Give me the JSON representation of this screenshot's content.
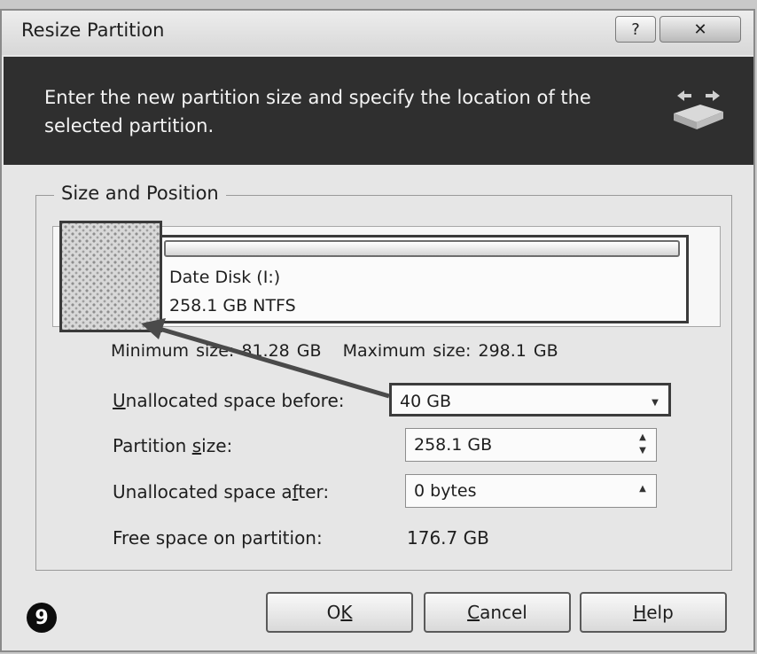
{
  "window": {
    "title": "Resize Partition",
    "help_glyph": "?",
    "close_glyph": "✕"
  },
  "header": {
    "instruction": "Enter the new partition size and specify the location of the selected partition.",
    "icon": "disk-resize-icon"
  },
  "size_position": {
    "group_label": "Size and Position",
    "partition_name": "Date Disk (I:)",
    "partition_info": "258.1 GB  NTFS",
    "minimum_size": "Minimum size: 81.28 GB",
    "maximum_size": "Maximum size: 298.1 GB",
    "fields": {
      "unallocated_before": {
        "label_key": "U",
        "label_rest": "nallocated space before:",
        "value": "40 GB",
        "control": "dropdown"
      },
      "partition_size": {
        "label_pre": "Partition ",
        "label_key": "s",
        "label_rest": "ize:",
        "value": "258.1 GB",
        "control": "spinner"
      },
      "unallocated_after": {
        "label_pre": "Unallocated space a",
        "label_key": "f",
        "label_rest": "ter:",
        "value": "0 bytes",
        "control": "spinner-up"
      }
    },
    "free_space_label": "Free space on partition:",
    "free_space_value": "176.7 GB"
  },
  "buttons": {
    "ok_key": "K",
    "ok_pre": "O",
    "cancel_key": "C",
    "cancel_rest": "ancel",
    "help_key": "H",
    "help_rest": "elp"
  },
  "step_badge": "9",
  "colors": {
    "header_background": "#2f2f2f",
    "dialog_background": "#e6e6e6"
  }
}
